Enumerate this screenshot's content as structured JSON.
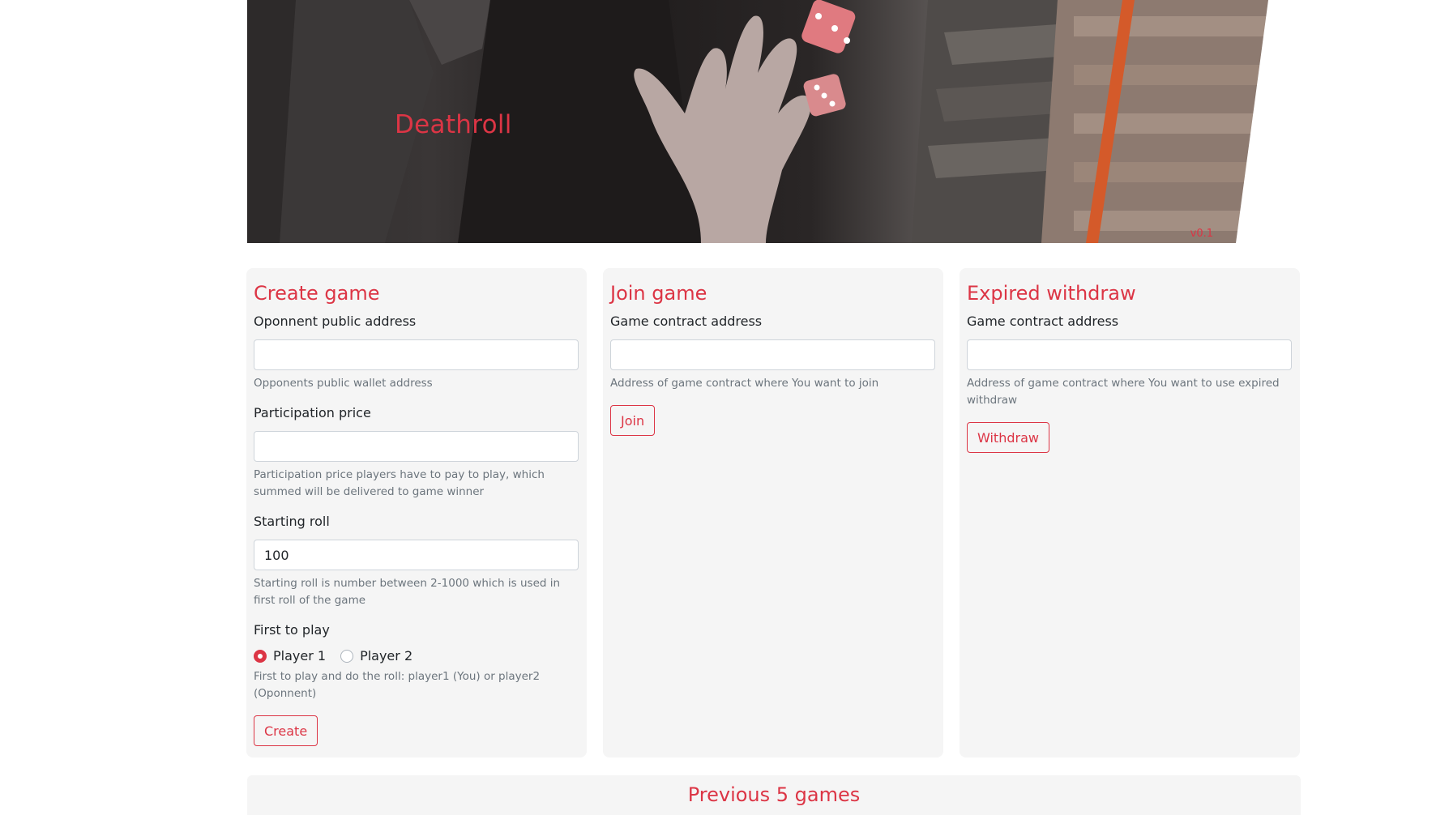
{
  "hero": {
    "title": "Deathroll",
    "version": "v0.1"
  },
  "create": {
    "title": "Create game",
    "opponent": {
      "label": "Oponnent public address",
      "value": "",
      "help": "Opponents public wallet address"
    },
    "price": {
      "label": "Participation price",
      "value": "",
      "help": "Participation price players have to pay to play, which summed will be delivered to game winner"
    },
    "roll": {
      "label": "Starting roll",
      "value": "100",
      "help": "Starting roll is number between 2-1000 which is used in first roll of the game"
    },
    "first": {
      "label": "First to play",
      "option1": "Player 1",
      "option2": "Player 2",
      "selected": "Player 1",
      "help": "First to play and do the roll: player1 (You) or player2 (Oponnent)"
    },
    "button": "Create"
  },
  "join": {
    "title": "Join game",
    "address": {
      "label": "Game contract address",
      "value": "",
      "help": "Address of game contract where You want to join"
    },
    "button": "Join"
  },
  "withdraw": {
    "title": "Expired withdraw",
    "address": {
      "label": "Game contract address",
      "value": "",
      "help": "Address of game contract where You want to use expired withdraw"
    },
    "button": "Withdraw"
  },
  "previous": {
    "title": "Previous 5 games"
  },
  "colors": {
    "accent": "#dc3545",
    "card_bg": "#f5f5f5"
  }
}
